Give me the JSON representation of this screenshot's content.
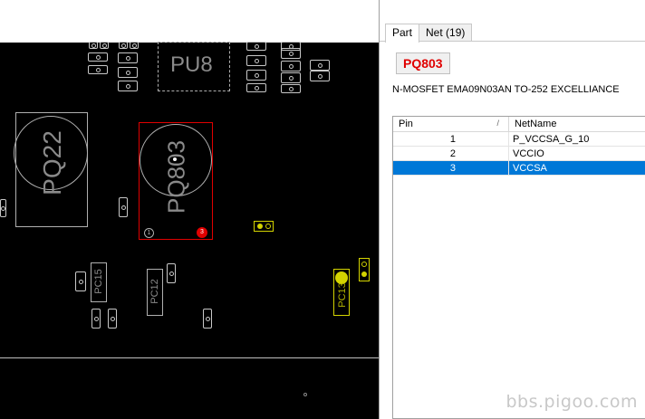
{
  "pcb": {
    "labels": {
      "pu8": "PU8",
      "pq22": "PQ22",
      "pq803": "PQ803",
      "pc_left": "PC15",
      "pc_mid": "PC12",
      "pc_right": "PC13",
      "pin1": "1",
      "pin3": "3"
    },
    "colors": {
      "background": "#000000",
      "outline": "#b0b0b0",
      "selected_outline": "#e00000",
      "highlight": "#d4d400"
    }
  },
  "panel": {
    "tabs": [
      {
        "label": "Part",
        "active": true
      },
      {
        "label": "Net (19)",
        "active": false
      }
    ],
    "part_name": "PQ803",
    "part_description": "N-MOSFET EMA09N03AN TO-252 EXCELLIANCE",
    "grid": {
      "columns": [
        "Pin",
        "NetName"
      ],
      "rows": [
        {
          "pin": "1",
          "net": "P_VCCSA_G_10",
          "selected": false
        },
        {
          "pin": "2",
          "net": "VCCIO",
          "selected": false
        },
        {
          "pin": "3",
          "net": "VCCSA",
          "selected": true
        }
      ]
    }
  },
  "watermark": "bbs.pigoo.com"
}
